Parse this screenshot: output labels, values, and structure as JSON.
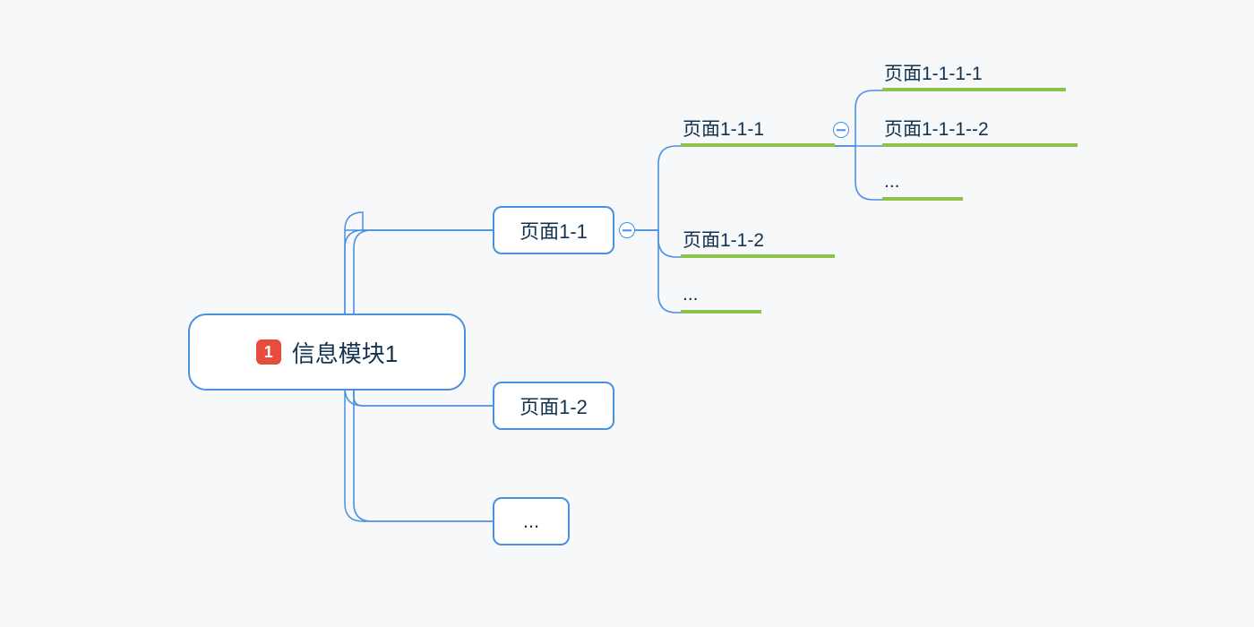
{
  "colors": {
    "background": "#f7f8fa",
    "nodeBorder": "#4a90e2",
    "connector": "#4a90e2",
    "underline": "#8bc34a",
    "badge": "#e74c3c",
    "text": "#12334f"
  },
  "toggleSymbol": "minus",
  "root": {
    "badge": "1",
    "label": "信息模块1"
  },
  "level2": [
    {
      "label": "页面1-1"
    },
    {
      "label": "页面1-2"
    },
    {
      "label": "..."
    }
  ],
  "level3": [
    {
      "label": "页面1-1-1"
    },
    {
      "label": "页面1-1-2"
    },
    {
      "label": "..."
    }
  ],
  "level4": [
    {
      "label": "页面1-1-1-1"
    },
    {
      "label": "页面1-1-1--2"
    },
    {
      "label": "..."
    }
  ]
}
